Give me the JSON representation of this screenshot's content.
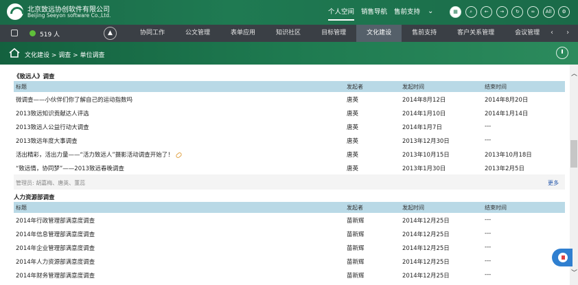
{
  "header": {
    "company_cn": "北京致远协创软件有限公司",
    "company_en": "Beijing Seeyon software Co.,Ltd.",
    "top_nav": [
      "个人空间",
      "销售导航",
      "售前支持"
    ],
    "icons": [
      "grid-icon",
      "search-icon",
      "back-icon",
      "forward-icon",
      "refresh-icon",
      "link-icon",
      "all-icon",
      "settings-icon"
    ],
    "all_label": "All"
  },
  "navbar": {
    "online_count": "519 人",
    "menu": [
      "协同工作",
      "公文管理",
      "表单应用",
      "知识社区",
      "目标管理",
      "文化建设",
      "售前支持",
      "客户关系管理",
      "会议管理"
    ],
    "active_menu": "文化建设"
  },
  "breadcrumb": "文化建设 > 调查 > 单位调查",
  "sections": [
    {
      "title": "《致远人》调查",
      "columns": [
        "标题",
        "发起者",
        "发起时间",
        "结束时间"
      ],
      "rows": [
        [
          "微调查——小伙伴们你了解自己的运动指数吗",
          "唐英",
          "2014年8月12日",
          "2014年8月20日"
        ],
        [
          "2013致远知识贡献达人评选",
          "唐英",
          "2014年1月10日",
          "2014年1月14日"
        ],
        [
          "2013致远人公益行动大调查",
          "唐英",
          "2014年1月7日",
          "---"
        ],
        [
          "2013致远年度大事调查",
          "唐英",
          "2013年12月30日",
          "---"
        ],
        [
          "活出精彩，活出力量——“活力致远人”摄影活动调查开始了！",
          "唐英",
          "2013年10月15日",
          "2013年10月18日"
        ],
        [
          "“致远情，协同梦”——2013致远春晚调查",
          "唐英",
          "2013年1月30日",
          "2013年2月5日"
        ]
      ],
      "admin": "管理员: 胡嘉梅、唐英、董蕊",
      "more": "更多"
    },
    {
      "title": "人力资源部调查",
      "columns": [
        "标题",
        "发起者",
        "发起时间",
        "结束时间"
      ],
      "rows": [
        [
          "2014年行政管理部满意度调查",
          "苗新辉",
          "2014年12月25日",
          "---"
        ],
        [
          "2014年信息管理部满意度调查",
          "苗新辉",
          "2014年12月25日",
          "---"
        ],
        [
          "2014年企业管理部满意度调查",
          "苗新辉",
          "2014年12月25日",
          "---"
        ],
        [
          "2014年人力资源部满意度调查",
          "苗新辉",
          "2014年12月25日",
          "---"
        ],
        [
          "2014年财务管理部满意度调查",
          "苗新辉",
          "2014年12月25日",
          "---"
        ]
      ]
    }
  ]
}
